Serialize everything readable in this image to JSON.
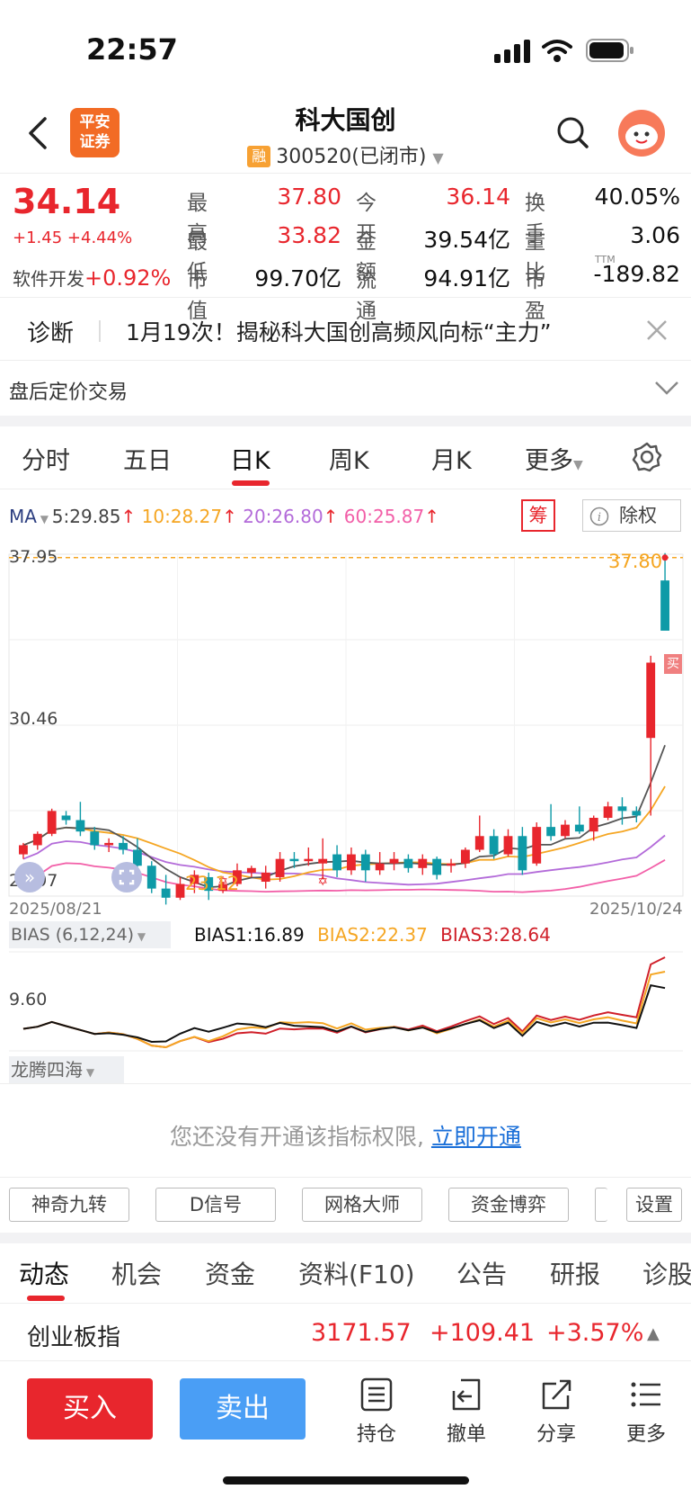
{
  "status_bar": {
    "time": "22:57"
  },
  "header": {
    "title": "科大国创",
    "rong_badge": "融",
    "subtitle": "300520(已闭市)",
    "logo_line1": "平安",
    "logo_line2": "证券"
  },
  "quote": {
    "price": "34.14",
    "change": "+1.45",
    "change_pct": "+4.44%",
    "sector_name": "软件开发",
    "sector_pct": "+0.92%",
    "fields": [
      {
        "label": "最高",
        "value": "37.80",
        "color": "red"
      },
      {
        "label": "今开",
        "value": "36.14",
        "color": "red"
      },
      {
        "label": "换手",
        "value": "40.05%",
        "color": "black"
      },
      {
        "label": "最低",
        "value": "33.82",
        "color": "red"
      },
      {
        "label": "金额",
        "value": "39.54亿",
        "color": "black"
      },
      {
        "label": "量比",
        "value": "3.06",
        "color": "black"
      },
      {
        "label": "市值",
        "value": "99.70亿",
        "color": "black"
      },
      {
        "label": "流通",
        "value": "94.91亿",
        "color": "black"
      },
      {
        "label": "市盈",
        "value": "-189.82",
        "color": "black"
      }
    ],
    "pe_superscript": "TTM"
  },
  "diagnosis": {
    "label": "诊断",
    "text": "1月19次！揭秘科大国创高频风向标“主力”"
  },
  "after_hours": {
    "label": "盘后定价交易"
  },
  "kline_tabs": [
    "分时",
    "五日",
    "日K",
    "周K",
    "月K",
    "更多"
  ],
  "ma_bar": {
    "label": "MA",
    "ma5": "5:29.85",
    "ma10": "10:28.27",
    "ma20": "20:26.80",
    "ma60": "60:25.87",
    "chip_btn": "筹",
    "exright_btn": "除权"
  },
  "chart_data": {
    "type": "candlestick",
    "y_top_label": "37.95",
    "y_mid_label": "30.46",
    "y_bottom_label": "22.97",
    "high_marker": "37.80",
    "low_marker": "23.12",
    "buy_marker": "买",
    "x_start": "2025/08/21",
    "x_end": "2025/10/24",
    "ylim": [
      22.97,
      37.95
    ],
    "candles": [
      [
        24.8,
        25.3,
        24.6,
        25.2
      ],
      [
        25.2,
        25.8,
        25.0,
        25.7
      ],
      [
        25.7,
        26.8,
        25.6,
        26.7
      ],
      [
        26.5,
        26.7,
        26.1,
        26.3
      ],
      [
        26.3,
        27.1,
        25.6,
        25.8
      ],
      [
        25.8,
        26.0,
        25.0,
        25.2
      ],
      [
        25.2,
        25.5,
        24.9,
        25.3
      ],
      [
        25.3,
        25.6,
        24.8,
        25.0
      ],
      [
        25.0,
        25.5,
        24.1,
        24.3
      ],
      [
        24.3,
        24.5,
        23.1,
        23.3
      ],
      [
        23.3,
        23.9,
        22.6,
        22.9
      ],
      [
        22.9,
        23.8,
        22.8,
        23.5
      ],
      [
        23.5,
        24.1,
        23.1,
        23.9
      ],
      [
        23.8,
        24.0,
        22.8,
        23.2
      ],
      [
        23.2,
        23.6,
        23.1,
        23.5
      ],
      [
        23.5,
        24.4,
        23.4,
        24.1
      ],
      [
        24.0,
        24.3,
        23.8,
        24.2
      ],
      [
        23.6,
        24.3,
        23.3,
        24.0
      ],
      [
        23.8,
        24.9,
        23.6,
        24.6
      ],
      [
        24.6,
        24.9,
        24.2,
        24.5
      ],
      [
        24.5,
        25.1,
        24.3,
        24.6
      ],
      [
        24.4,
        25.5,
        23.7,
        24.6
      ],
      [
        24.8,
        25.2,
        23.8,
        24.1
      ],
      [
        24.1,
        25.1,
        23.9,
        24.8
      ],
      [
        24.8,
        25.0,
        23.6,
        24.1
      ],
      [
        24.1,
        24.9,
        23.9,
        24.4
      ],
      [
        24.4,
        24.9,
        24.1,
        24.6
      ],
      [
        24.6,
        24.8,
        24.0,
        24.2
      ],
      [
        24.2,
        24.8,
        23.9,
        24.6
      ],
      [
        24.6,
        24.7,
        23.7,
        23.9
      ],
      [
        24.3,
        24.6,
        24.0,
        24.4
      ],
      [
        24.4,
        25.1,
        24.2,
        25.0
      ],
      [
        25.0,
        26.5,
        24.9,
        25.6
      ],
      [
        25.6,
        25.9,
        24.6,
        24.8
      ],
      [
        24.8,
        25.9,
        24.7,
        25.6
      ],
      [
        25.6,
        26.0,
        23.9,
        24.1
      ],
      [
        24.4,
        26.2,
        24.3,
        26.0
      ],
      [
        26.0,
        27.0,
        25.4,
        25.6
      ],
      [
        25.6,
        26.3,
        25.5,
        26.1
      ],
      [
        26.1,
        26.9,
        25.7,
        25.8
      ],
      [
        25.8,
        26.5,
        25.4,
        26.4
      ],
      [
        26.4,
        27.1,
        26.3,
        26.9
      ],
      [
        26.9,
        27.3,
        26.1,
        26.7
      ],
      [
        26.7,
        26.9,
        26.2,
        26.5
      ],
      [
        29.9,
        33.5,
        26.5,
        33.2
      ],
      [
        36.8,
        38.0,
        36.0,
        34.6
      ]
    ]
  },
  "bias": {
    "label": "BIAS (6,12,24)",
    "bias1": "BIAS1:16.89",
    "bias2": "BIAS2:22.37",
    "bias3": "BIAS3:28.64",
    "axis_label": "9.60"
  },
  "longteng": {
    "label": "龙腾四海",
    "notice": "您还没有开通该指标权限,",
    "link": "立即开通"
  },
  "indicator_buttons": [
    "神奇九转",
    "D信号",
    "网格大师",
    "资金博弈"
  ],
  "settings_btn": "设置",
  "bottom_tabs": [
    "动态",
    "机会",
    "资金",
    "资料(F10)",
    "公告",
    "研报",
    "诊股"
  ],
  "index_ticker": {
    "name": "创业板指",
    "value": "3171.57",
    "change": "+109.41",
    "pct": "+3.57%"
  },
  "actions": {
    "buy": "买入",
    "sell": "卖出",
    "hold": "持仓",
    "cancel": "撤单",
    "share": "分享",
    "more": "更多"
  },
  "colors": {
    "up": "#e8262d",
    "down": "#0e9aa7",
    "ma5": "#555555",
    "ma10": "#f5a623",
    "ma20": "#b36bd9",
    "ma60": "#f25fa8",
    "sell_blue": "#4a9ef5"
  }
}
